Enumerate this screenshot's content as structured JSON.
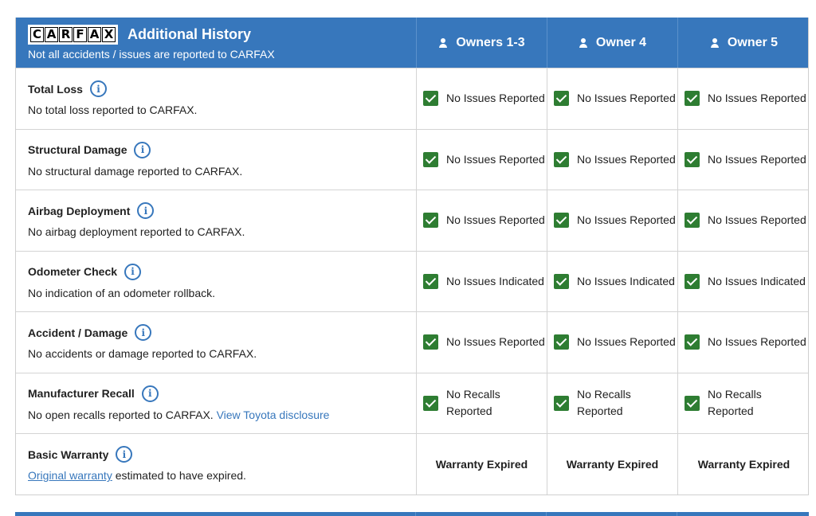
{
  "header": {
    "logo_letters": [
      "C",
      "A",
      "R",
      "F",
      "A",
      "X"
    ],
    "title": "Additional History",
    "subtitle": "Not all accidents / issues are reported to CARFAX",
    "owners": [
      "Owners 1-3",
      "Owner 4",
      "Owner 5"
    ]
  },
  "rows": [
    {
      "title": "Total Loss",
      "desc": "No total loss reported to CARFAX.",
      "status": [
        "No Issues Reported",
        "No Issues Reported",
        "No Issues Reported"
      ]
    },
    {
      "title": "Structural Damage",
      "desc": "No structural damage reported to CARFAX.",
      "status": [
        "No Issues Reported",
        "No Issues Reported",
        "No Issues Reported"
      ]
    },
    {
      "title": "Airbag Deployment",
      "desc": "No airbag deployment reported to CARFAX.",
      "status": [
        "No Issues Reported",
        "No Issues Reported",
        "No Issues Reported"
      ]
    },
    {
      "title": "Odometer Check",
      "desc": "No indication of an odometer rollback.",
      "status": [
        "No Issues Indicated",
        "No Issues Indicated",
        "No Issues Indicated"
      ]
    },
    {
      "title": "Accident / Damage",
      "desc": "No accidents or damage reported to CARFAX.",
      "status": [
        "No Issues Reported",
        "No Issues Reported",
        "No Issues Reported"
      ]
    },
    {
      "title": "Manufacturer Recall",
      "desc": "No open recalls reported to CARFAX.",
      "link": "View Toyota disclosure",
      "status_line1": "No Recalls",
      "status_line2": "Reported"
    },
    {
      "title": "Basic Warranty",
      "link": "Original warranty",
      "desc": "estimated to have expired.",
      "status": [
        "Warranty Expired",
        "Warranty Expired",
        "Warranty Expired"
      ]
    }
  ],
  "info_glyph": "i",
  "colors": {
    "brand_blue": "#3777bc",
    "check_green": "#2e7d32"
  }
}
